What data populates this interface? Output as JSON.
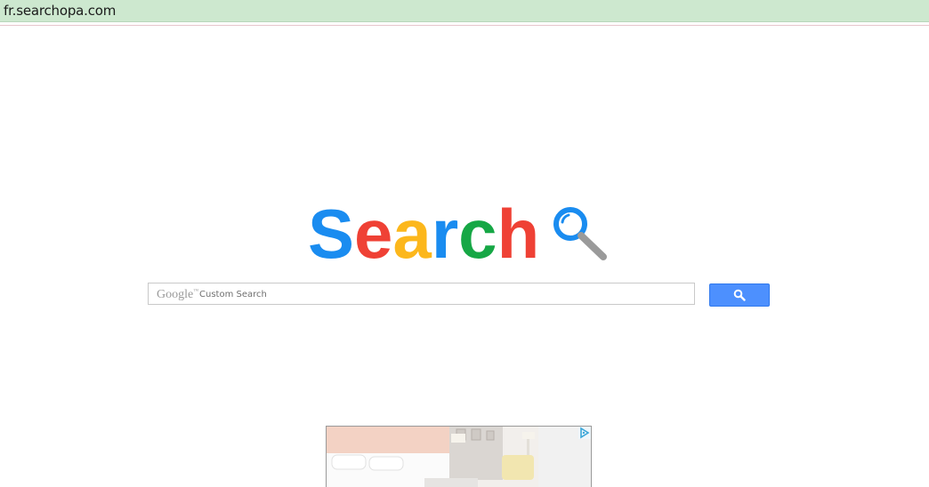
{
  "browser": {
    "url": "fr.searchopa.com"
  },
  "logo": {
    "letters": [
      {
        "char": "S",
        "color": "#1a8cf0"
      },
      {
        "char": "e",
        "color": "#ef4135"
      },
      {
        "char": "a",
        "color": "#fcb71c"
      },
      {
        "char": "r",
        "color": "#1a8cf0"
      },
      {
        "char": "c",
        "color": "#16a745"
      },
      {
        "char": "h",
        "color": "#ef4135"
      }
    ],
    "icon": "magnifier-icon"
  },
  "search": {
    "brand": "Google",
    "brand_mark": "™",
    "placeholder": "Custom Search",
    "button_icon": "search-icon",
    "button_color": "#4d90fe"
  },
  "ad": {
    "badge_icon": "adchoices-icon"
  }
}
